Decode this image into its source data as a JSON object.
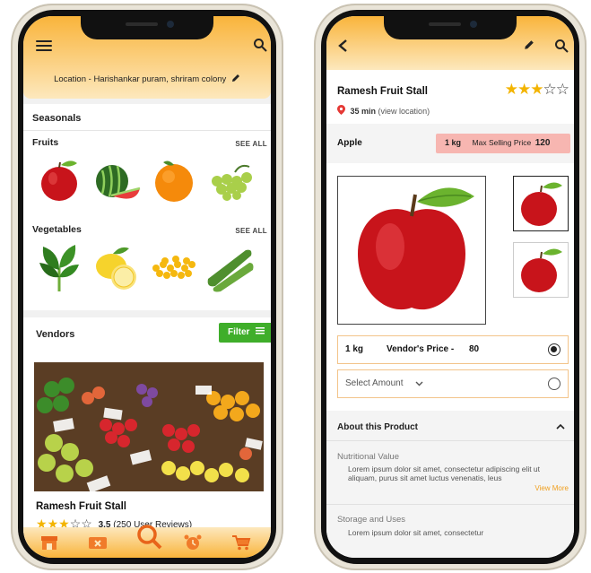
{
  "left": {
    "location_text": "Location - Harishankar puram, shriram colony",
    "seasonals_title": "Seasonals",
    "fruits_title": "Fruits",
    "vegetables_title": "Vegetables",
    "see_all": "SEE ALL",
    "vendors_title": "Vendors",
    "filter_label": "Filter",
    "vendor_name": "Ramesh Fruit Stall",
    "rating_value": "3.5",
    "rating_reviews": "(250 User Reviews)",
    "rating_stars": 3
  },
  "right": {
    "stall_name": "Ramesh Fruit Stall",
    "time": "35 min",
    "view_location": "(view location)",
    "stars": 3,
    "product_name": "Apple",
    "chip_qty": "1 kg",
    "chip_label": "Max Selling Price",
    "chip_price": "120",
    "option1_qty": "1 kg",
    "option1_label": "Vendor's Price -",
    "option1_price": "80",
    "select_amount": "Select Amount",
    "about_title": "About this Product",
    "nutrition_title": "Nutritional Value",
    "nutrition_text": "Lorem ipsum dolor sit amet, consectetur adipiscing elit ut aliquam, purus sit amet luctus venenatis, leus",
    "view_more": "View More",
    "storage_title": "Storage and Uses",
    "storage_text": "Lorem ipsum dolor sit amet, consectetur"
  },
  "colors": {
    "accent": "#f9b43b",
    "green": "#3fae2a",
    "chip": "#f7b6b1",
    "pin": "#e53935",
    "link": "#f0a020"
  }
}
